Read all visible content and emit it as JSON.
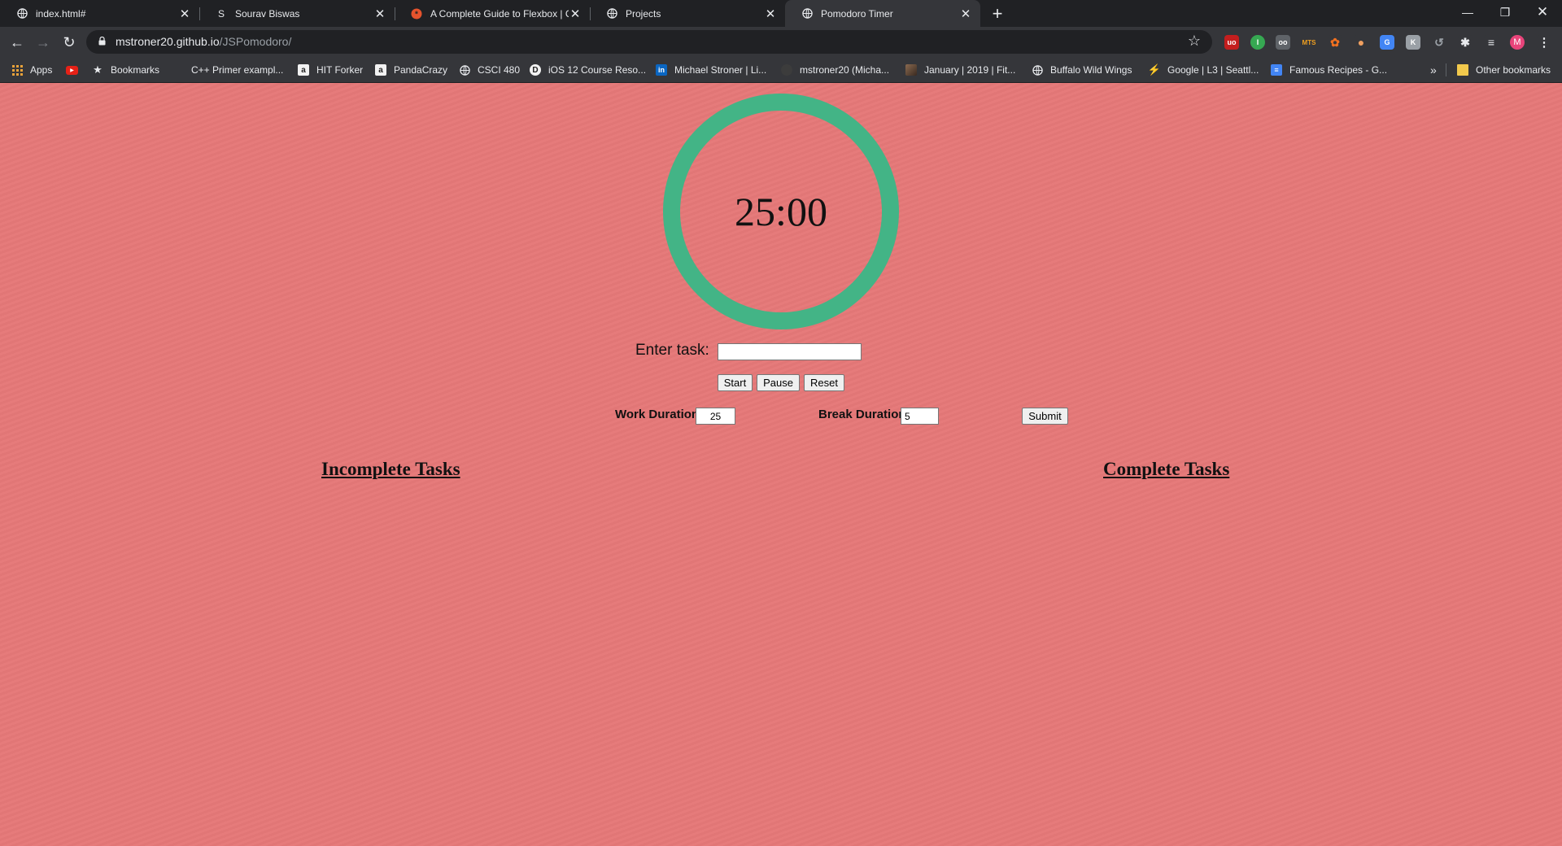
{
  "browser": {
    "tabs": [
      {
        "title": "index.html#",
        "icon": "globe-icon"
      },
      {
        "title": "Sourav Biswas",
        "icon": "S"
      },
      {
        "title": "A Complete Guide to Flexbox | C",
        "icon": "css-tricks-icon"
      },
      {
        "title": "Projects",
        "icon": "globe-icon"
      },
      {
        "title": "Pomodoro Timer",
        "icon": "globe-icon"
      }
    ],
    "url_host": "mstroner20.github.io",
    "url_path": "/JSPomodoro/",
    "profile_initial": "M",
    "bookmarks": [
      {
        "label": "Apps",
        "icon": "apps-grid-icon"
      },
      {
        "label": "",
        "icon": "youtube-icon"
      },
      {
        "label": "Bookmarks",
        "icon": "star-icon"
      },
      {
        "label": "C++ Primer exampl...",
        "icon": "blank-icon"
      },
      {
        "label": "HIT Forker",
        "icon": "amazon-icon"
      },
      {
        "label": "PandaCrazy",
        "icon": "amazon-icon"
      },
      {
        "label": "CSCI 480",
        "icon": "globe-icon"
      },
      {
        "label": "iOS 12 Course Reso...",
        "icon": "d-icon"
      },
      {
        "label": "Michael Stroner | Li...",
        "icon": "linkedin-icon"
      },
      {
        "label": "mstroner20 (Micha...",
        "icon": "github-icon"
      },
      {
        "label": "January | 2019 | Fit...",
        "icon": "photo-icon"
      },
      {
        "label": "Buffalo Wild Wings",
        "icon": "globe-icon"
      },
      {
        "label": "Google | L3 | Seattl...",
        "icon": "bolt-icon"
      },
      {
        "label": "Famous Recipes - G...",
        "icon": "docs-icon"
      }
    ],
    "overflow": "»",
    "other_bookmarks": "Other bookmarks"
  },
  "app": {
    "timer": "25:00",
    "task_label": "Enter task:",
    "task_value": "",
    "start_label": "Start",
    "pause_label": "Pause",
    "reset_label": "Reset",
    "work_duration_label": "Work Duration",
    "work_duration_value": "25",
    "break_duration_label": "Break Duration",
    "break_duration_value": "5",
    "submit_label": "Submit",
    "incomplete_heading": "Incomplete Tasks",
    "complete_heading": "Complete Tasks",
    "background_color": "#e57878",
    "ring_color": "#43b486"
  }
}
